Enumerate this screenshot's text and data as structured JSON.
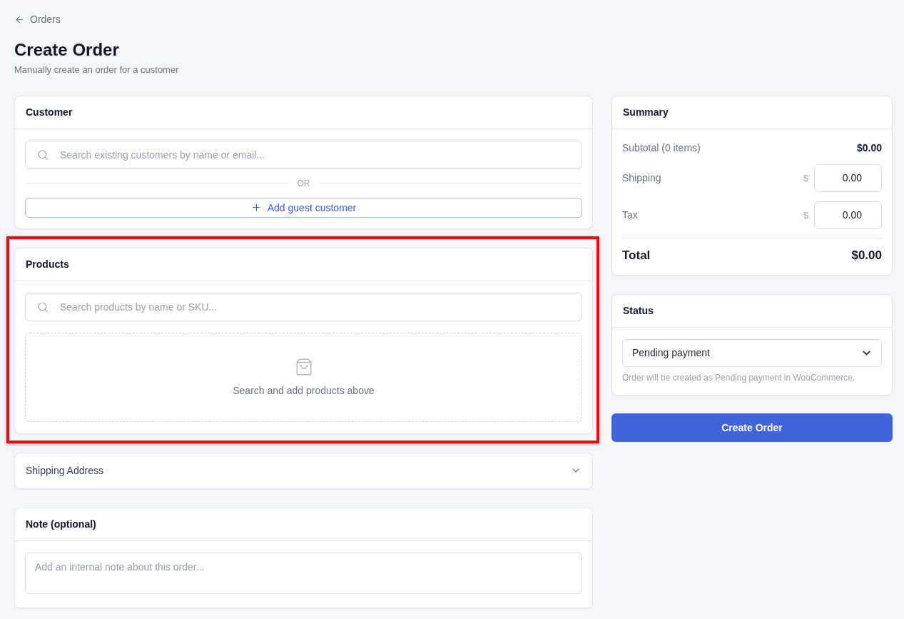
{
  "back_link": {
    "label": "Orders"
  },
  "page": {
    "title": "Create Order",
    "subtitle": "Manually create an order for a customer"
  },
  "customer": {
    "title": "Customer",
    "search": {
      "placeholder": "Search existing customers by name or email..."
    },
    "divider_label": "OR",
    "add_guest_button": "Add guest customer"
  },
  "products": {
    "title": "Products",
    "highlighted": true,
    "search": {
      "placeholder": "Search products by name or SKU..."
    },
    "empty_message": "Search and add products above"
  },
  "shipping_address": {
    "title": "Shipping Address",
    "expanded": false
  },
  "note": {
    "title": "Note (optional)",
    "field": {
      "placeholder": "Add an internal note about this order..."
    }
  },
  "summary": {
    "title": "Summary",
    "subtotal": {
      "label": "Subtotal (0 items)",
      "value": "$0.00"
    },
    "fees": [
      {
        "label": "Shipping",
        "currency": "$",
        "value": "0.00"
      },
      {
        "label": "Tax",
        "currency": "$",
        "value": "0.00"
      }
    ],
    "total": {
      "label": "Total",
      "value": "$0.00"
    }
  },
  "status": {
    "title": "Status",
    "select": {
      "value": "Pending payment"
    },
    "help": "Order will be created as Pending payment in WooCommerce."
  },
  "create_button": "Create Order"
}
